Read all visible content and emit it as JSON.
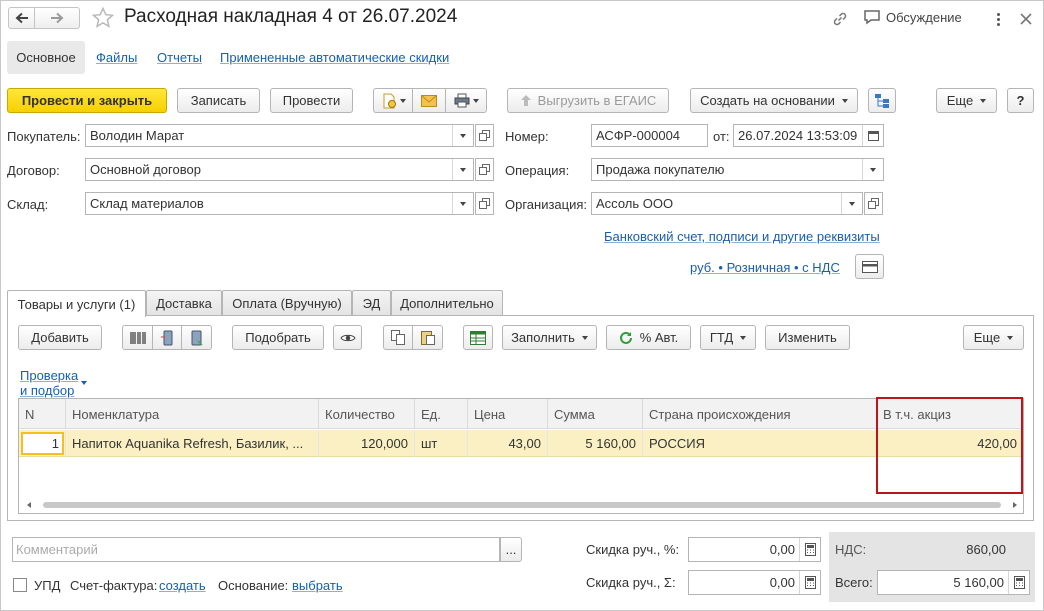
{
  "window": {
    "title": "Расходная накладная 4 от 26.07.2024",
    "discussion_label": "Обсуждение"
  },
  "nav_tabs": [
    "Основное",
    "Файлы",
    "Отчеты",
    "Примененные автоматические скидки"
  ],
  "toolbar": {
    "post_close": "Провести и закрыть",
    "save": "Записать",
    "post": "Провести",
    "upload_egais": "Выгрузить в ЕГАИС",
    "create_based": "Создать на основании",
    "more": "Еще",
    "help": "?"
  },
  "form": {
    "buyer_label": "Покупатель:",
    "buyer_value": "Володин Марат",
    "contract_label": "Договор:",
    "contract_value": "Основной договор",
    "warehouse_label": "Склад:",
    "warehouse_value": "Склад материалов",
    "number_label": "Номер:",
    "number_value": "АСФР-000004",
    "date_label": "от:",
    "date_value": "26.07.2024 13:53:09",
    "operation_label": "Операция:",
    "operation_value": "Продажа покупателю",
    "org_label": "Организация:",
    "org_value": "Ассоль ООО",
    "bank_link": "Банковский счет, подписи и другие реквизиты",
    "price_link": "руб. • Розничная • с НДС"
  },
  "doc_tabs": [
    "Товары и услуги (1)",
    "Доставка",
    "Оплата (Вручную)",
    "ЭД",
    "Дополнительно"
  ],
  "table_toolbar": {
    "add": "Добавить",
    "pick": "Подобрать",
    "fill": "Заполнить",
    "auto_pct": "% Авт.",
    "gtd": "ГТД",
    "change": "Изменить",
    "more": "Еще",
    "check_link": "Проверка и подбор"
  },
  "table": {
    "columns": [
      "N",
      "Номенклатура",
      "Количество",
      "Ед.",
      "Цена",
      "Сумма",
      "Страна происхождения",
      "В т.ч. акциз"
    ],
    "rows": [
      {
        "n": "1",
        "item": "Напиток Aquanika Refresh, Базилик, ...",
        "qty": "120,000",
        "unit": "шт",
        "price": "43,00",
        "sum": "5 160,00",
        "country": "РОССИЯ",
        "excise": "420,00"
      }
    ]
  },
  "footer": {
    "comment_placeholder": "Комментарий",
    "more_dots": "...",
    "upd_label": "УПД",
    "invoice_label": "Счет-фактура:",
    "invoice_link": "создать",
    "basis_label": "Основание:",
    "basis_link": "выбрать",
    "discount_pct_label": "Скидка руч., %:",
    "discount_pct_value": "0,00",
    "discount_sum_label": "Скидка руч., Σ:",
    "discount_sum_value": "0,00",
    "vat_label": "НДС:",
    "vat_value": "860,00",
    "total_label": "Всего:",
    "total_value": "5 160,00"
  },
  "colors": {
    "accent_yellow": "#f6d100",
    "selected_row": "#fbf0c4",
    "highlight_box": "#c0141c",
    "link": "#1a5fa8"
  }
}
